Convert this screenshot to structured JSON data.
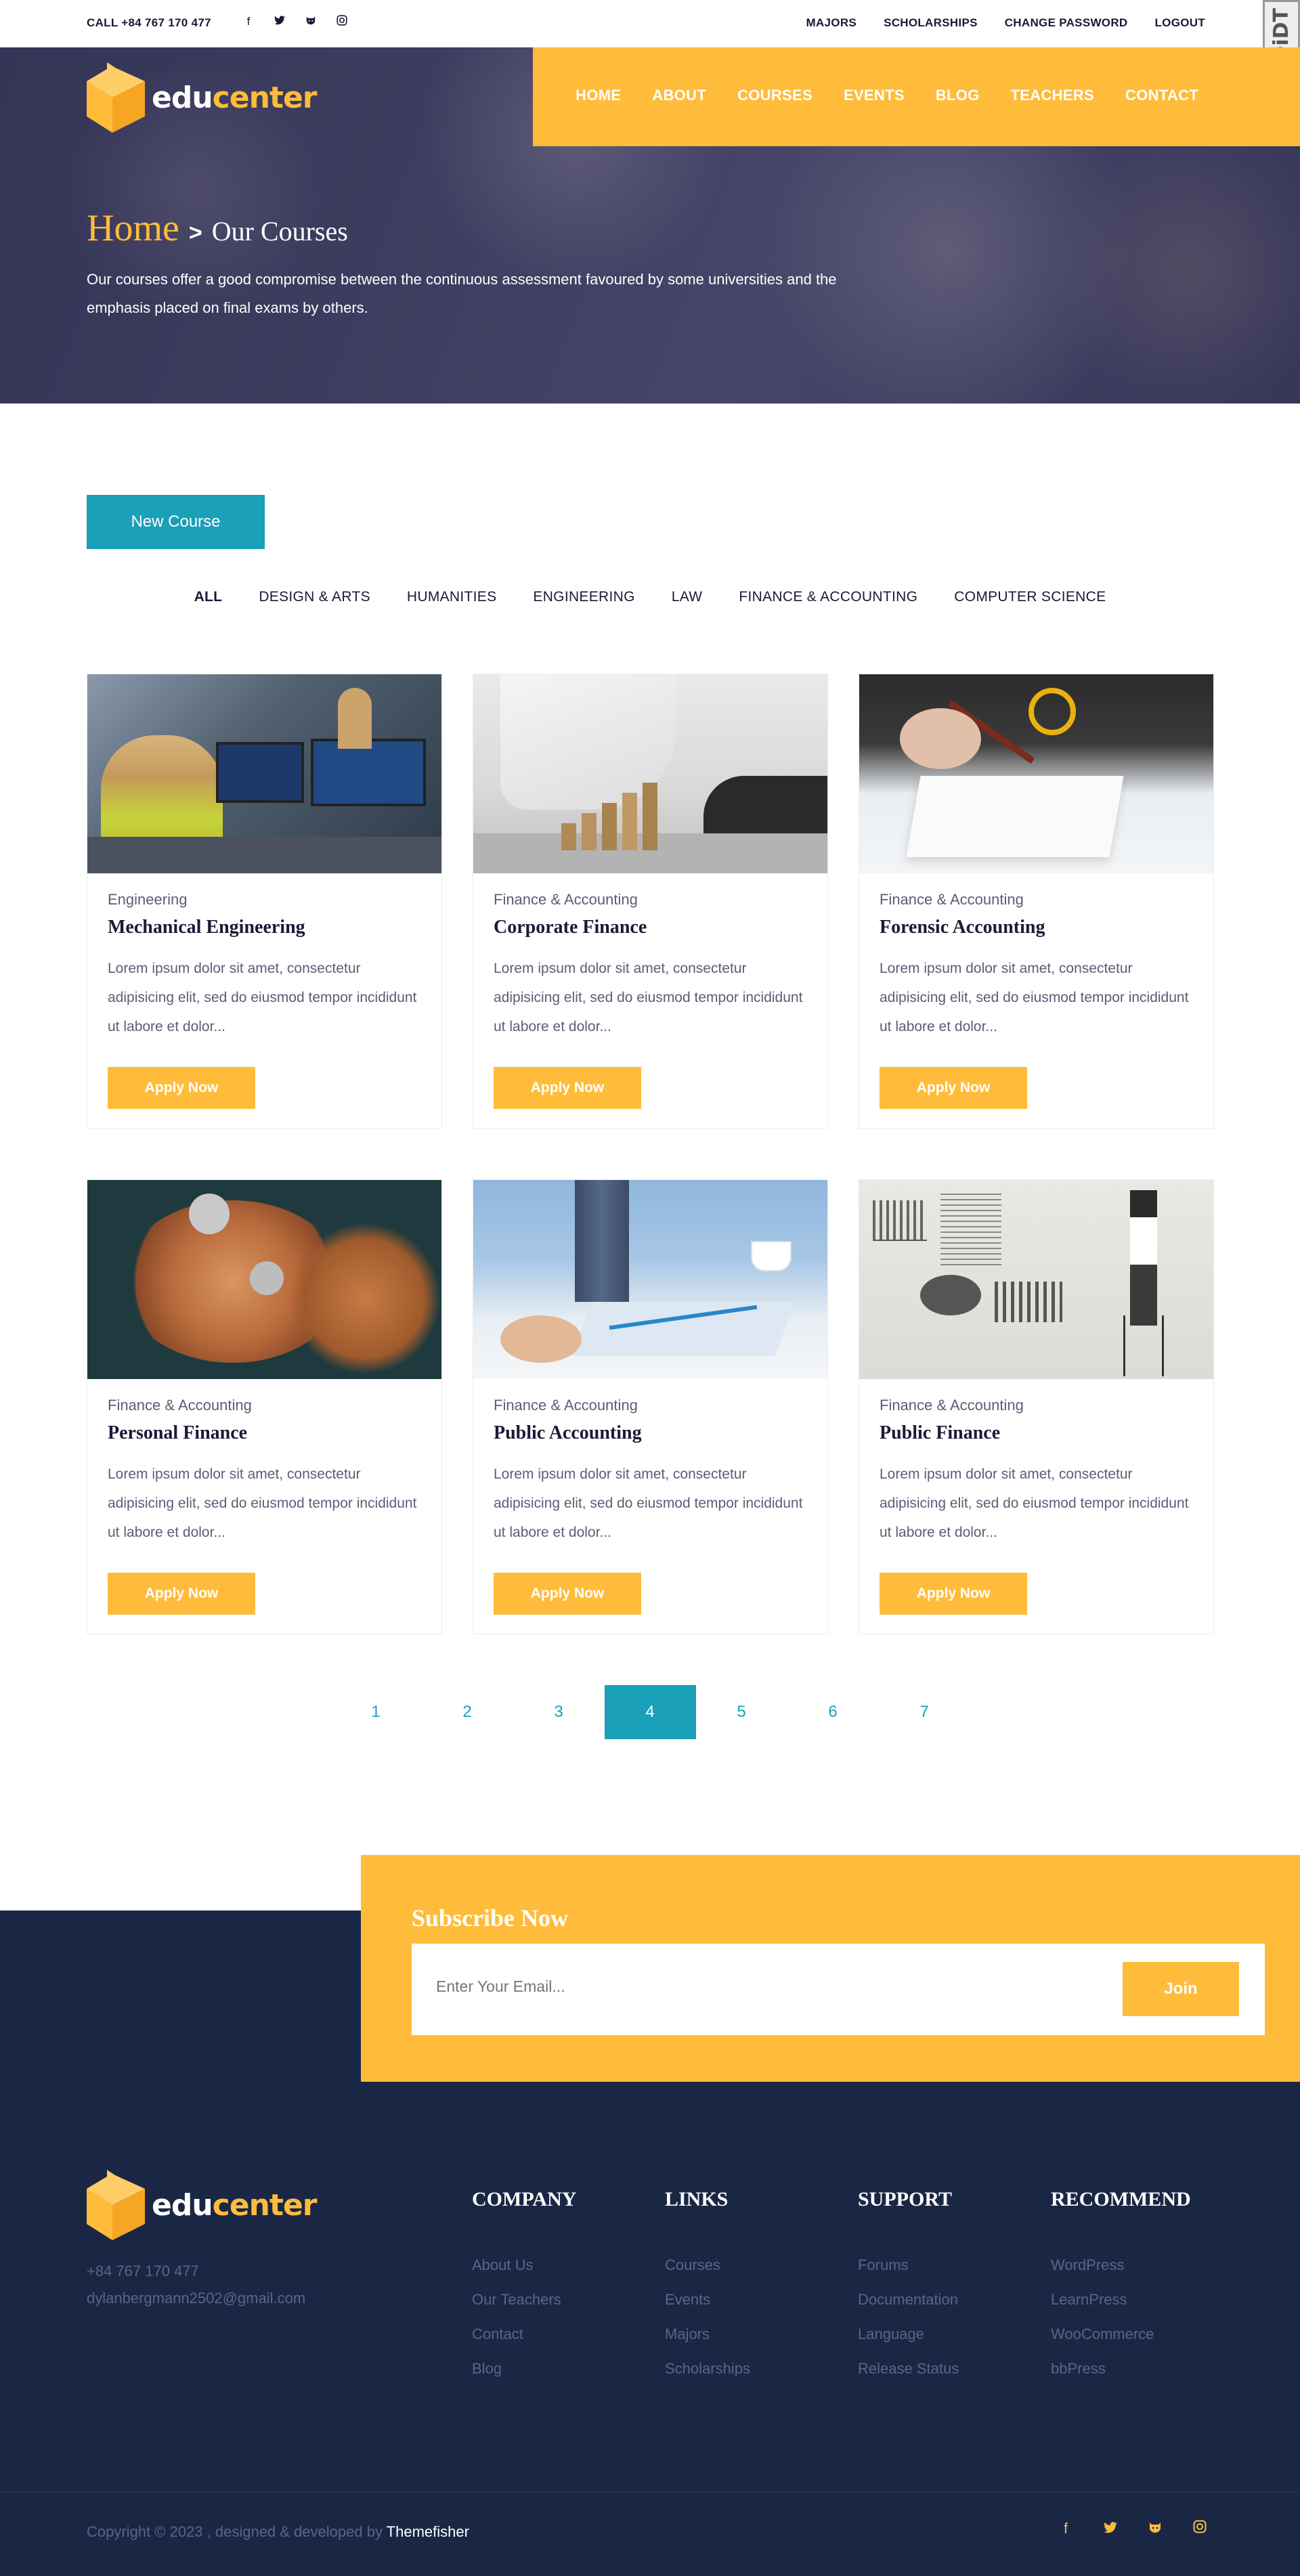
{
  "topbar": {
    "call": "CALL +84 767 170 477",
    "social_icons": [
      "facebook-icon",
      "twitter-icon",
      "github-icon",
      "instagram-icon"
    ],
    "links": [
      "MAJORS",
      "SCHOLARSHIPS",
      "CHANGE PASSWORD",
      "LOGOUT"
    ],
    "badge": "DiDT"
  },
  "logo": {
    "edu": "edu",
    "center": "center"
  },
  "nav": {
    "items": [
      "HOME",
      "ABOUT",
      "COURSES",
      "EVENTS",
      "BLOG",
      "TEACHERS",
      "CONTACT"
    ]
  },
  "hero": {
    "home": "Home",
    "separator": ">",
    "current": "Our Courses",
    "description": "Our courses offer a good compromise between the continuous assessment favoured by some universities and the emphasis placed on final exams by others."
  },
  "new_course_label": "New Course",
  "filters": [
    "ALL",
    "DESIGN & ARTS",
    "HUMANITIES",
    "ENGINEERING",
    "LAW",
    "FINANCE & ACCOUNTING",
    "COMPUTER SCIENCE"
  ],
  "courses": [
    {
      "category": "Engineering",
      "title": "Mechanical Engineering",
      "description": "Lorem ipsum dolor sit amet, consectetur adipisicing elit, sed do eiusmod tempor incididunt ut labore et dolor...",
      "button": "Apply Now"
    },
    {
      "category": "Finance & Accounting",
      "title": "Corporate Finance",
      "description": "Lorem ipsum dolor sit amet, consectetur adipisicing elit, sed do eiusmod tempor incididunt ut labore et dolor...",
      "button": "Apply Now"
    },
    {
      "category": "Finance & Accounting",
      "title": "Forensic Accounting",
      "description": "Lorem ipsum dolor sit amet, consectetur adipisicing elit, sed do eiusmod tempor incididunt ut labore et dolor...",
      "button": "Apply Now"
    },
    {
      "category": "Finance & Accounting",
      "title": "Personal Finance",
      "description": "Lorem ipsum dolor sit amet, consectetur adipisicing elit, sed do eiusmod tempor incididunt ut labore et dolor...",
      "button": "Apply Now"
    },
    {
      "category": "Finance & Accounting",
      "title": "Public Accounting",
      "description": "Lorem ipsum dolor sit amet, consectetur adipisicing elit, sed do eiusmod tempor incididunt ut labore et dolor...",
      "button": "Apply Now"
    },
    {
      "category": "Finance & Accounting",
      "title": "Public Finance",
      "description": "Lorem ipsum dolor sit amet, consectetur adipisicing elit, sed do eiusmod tempor incididunt ut labore et dolor...",
      "button": "Apply Now"
    }
  ],
  "pagination": {
    "pages": [
      "1",
      "2",
      "3",
      "4",
      "5",
      "6",
      "7"
    ],
    "active": "4"
  },
  "subscribe": {
    "title": "Subscribe Now",
    "placeholder": "Enter Your Email...",
    "button": "Join"
  },
  "footer": {
    "phone": "+84 767 170 477",
    "email": "dylanbergmann2502@gmail.com",
    "columns": [
      {
        "heading": "COMPANY",
        "links": [
          "About Us",
          "Our Teachers",
          "Contact",
          "Blog"
        ]
      },
      {
        "heading": "LINKS",
        "links": [
          "Courses",
          "Events",
          "Majors",
          "Scholarships"
        ]
      },
      {
        "heading": "SUPPORT",
        "links": [
          "Forums",
          "Documentation",
          "Language",
          "Release Status"
        ]
      },
      {
        "heading": "RECOMMEND",
        "links": [
          "WordPress",
          "LearnPress",
          "WooCommerce",
          "bbPress"
        ]
      }
    ],
    "copyright": "Copyright © 2023 , designed & developed by ",
    "brand": "Themefisher",
    "social_icons": [
      "facebook-icon",
      "twitter-icon",
      "github-icon",
      "instagram-icon"
    ]
  },
  "colors": {
    "accent": "#ffbc3b",
    "primary": "#1aa0b8",
    "dark": "#1a2744",
    "heading": "#1a1a37"
  }
}
